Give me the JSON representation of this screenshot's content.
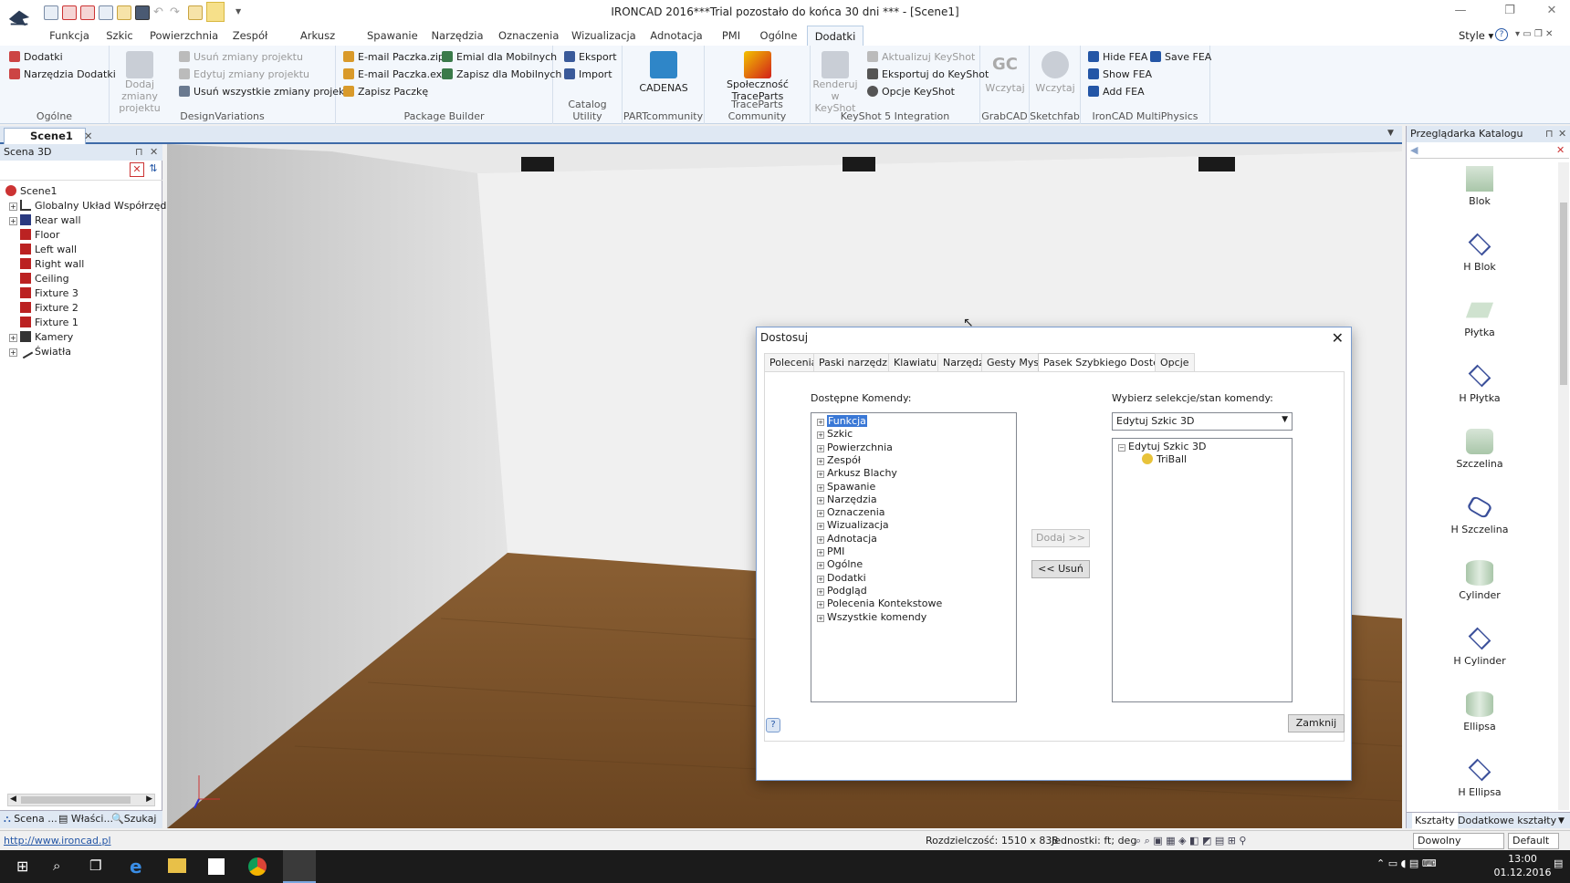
{
  "titlebar": {
    "title": "IRONCAD 2016***Trial pozostało do końca 30 dni *** - [Scene1]"
  },
  "menu": {
    "tabs": [
      "Funkcja",
      "Szkic",
      "Powierzchnia",
      "Zespół",
      "Arkusz Blachy",
      "Spawanie",
      "Narzędzia",
      "Oznaczenia",
      "Wizualizacja",
      "Adnotacja",
      "PMI",
      "Ogólne",
      "Dodatki"
    ],
    "active": "Dodatki",
    "style_label": "Style"
  },
  "ribbon": {
    "ogolne": {
      "items": [
        "Dodatki",
        "Narzędzia Dodatki"
      ],
      "label": "Ogólne"
    },
    "designvariations": {
      "big": "Dodaj zmiany projektu",
      "items": [
        "Usuń zmiany projektu",
        "Edytuj zmiany projektu",
        "Usuń wszystkie zmiany projektu"
      ],
      "label": "DesignVariations"
    },
    "package": {
      "items": [
        "E-mail Paczka.zip",
        "E-mail Paczka.exe",
        "Zapisz Paczkę",
        "Emial dla Mobilnych",
        "Zapisz dla Mobilnych"
      ],
      "label": "Package Builder"
    },
    "catalog": {
      "items": [
        "Eksport",
        "Import"
      ],
      "label": "Catalog Utility"
    },
    "partcommunity": {
      "big": "CADENAS",
      "label": "PARTcommunity"
    },
    "traceparts": {
      "big": "Społeczność TraceParts",
      "label": "TraceParts Community"
    },
    "keyshot": {
      "big": "Renderuj w KeyShot",
      "items": [
        "Aktualizuj KeyShot",
        "Eksportuj do KeyShot",
        "Opcje KeyShot"
      ],
      "label": "KeyShot 5 Integration"
    },
    "grabcad": {
      "big": "Wczytaj",
      "label": "GrabCAD"
    },
    "sketchfab": {
      "big": "Wczytaj",
      "label": "Sketchfab"
    },
    "multiphysics": {
      "items": [
        "Hide FEA",
        "Show FEA",
        "Add FEA",
        "Save FEA"
      ],
      "label": "IronCAD MultiPhysics"
    }
  },
  "doc_tab": "Scene1",
  "scene_panel": {
    "title": "Scena 3D",
    "tree": [
      "Scene1",
      "Globalny Układ Współrzędny",
      "Rear wall",
      "Floor",
      "Left wall",
      "Right wall",
      "Ceiling",
      "Fixture 3",
      "Fixture 2",
      "Fixture 1",
      "Kamery",
      "Światła"
    ],
    "bottom_tabs": [
      "Scena ...",
      "Właści...",
      "Szukaj"
    ]
  },
  "catalog_panel": {
    "title": "Przeglądarka Katalogu",
    "items": [
      "Blok",
      "H Blok",
      "Płytka",
      "H Płytka",
      "Szczelina",
      "H Szczelina",
      "Cylinder",
      "H Cylinder",
      "Ellipsa",
      "H Ellipsa"
    ],
    "bottom_tabs": [
      "Kształty",
      "Dodatkowe kształty"
    ]
  },
  "dialog": {
    "title": "Dostosuj",
    "tabs": [
      "Polecenia",
      "Paski narzędzi",
      "Klawiatura",
      "Narzędzia",
      "Gesty Myszy",
      "Pasek Szybkiego Dostępu",
      "Opcje"
    ],
    "active_tab": "Pasek Szybkiego Dostępu",
    "available_label": "Dostępne Komendy:",
    "available": [
      "Funkcja",
      "Szkic",
      "Powierzchnia",
      "Zespół",
      "Arkusz Blachy",
      "Spawanie",
      "Narzędzia",
      "Oznaczenia",
      "Wizualizacja",
      "Adnotacja",
      "PMI",
      "Ogólne",
      "Dodatki",
      "Podgląd",
      "Polecenia Kontekstowe",
      "Wszystkie komendy"
    ],
    "select_label": "Wybierz selekcje/stan komendy:",
    "select_value": "Edytuj Szkic 3D",
    "right_tree_root": "Edytuj Szkic 3D",
    "right_tree_child": "TriBall",
    "add_button": "Dodaj >>",
    "remove_button": "<< Usuń",
    "close_button": "Zamknij"
  },
  "status": {
    "link": "http://www.ironcad.pl",
    "resolution": "Rozdzielczość: 1510 x 838",
    "units": "Jednostki: ft; deg",
    "mode": "Dowolny",
    "profile": "Default"
  },
  "taskbar": {
    "time": "13:00",
    "date": "01.12.2016"
  },
  "colors": {
    "accent": "#3e6aa8",
    "selection": "#3a78d6",
    "ribbon_bg": "#f3f7fc"
  }
}
